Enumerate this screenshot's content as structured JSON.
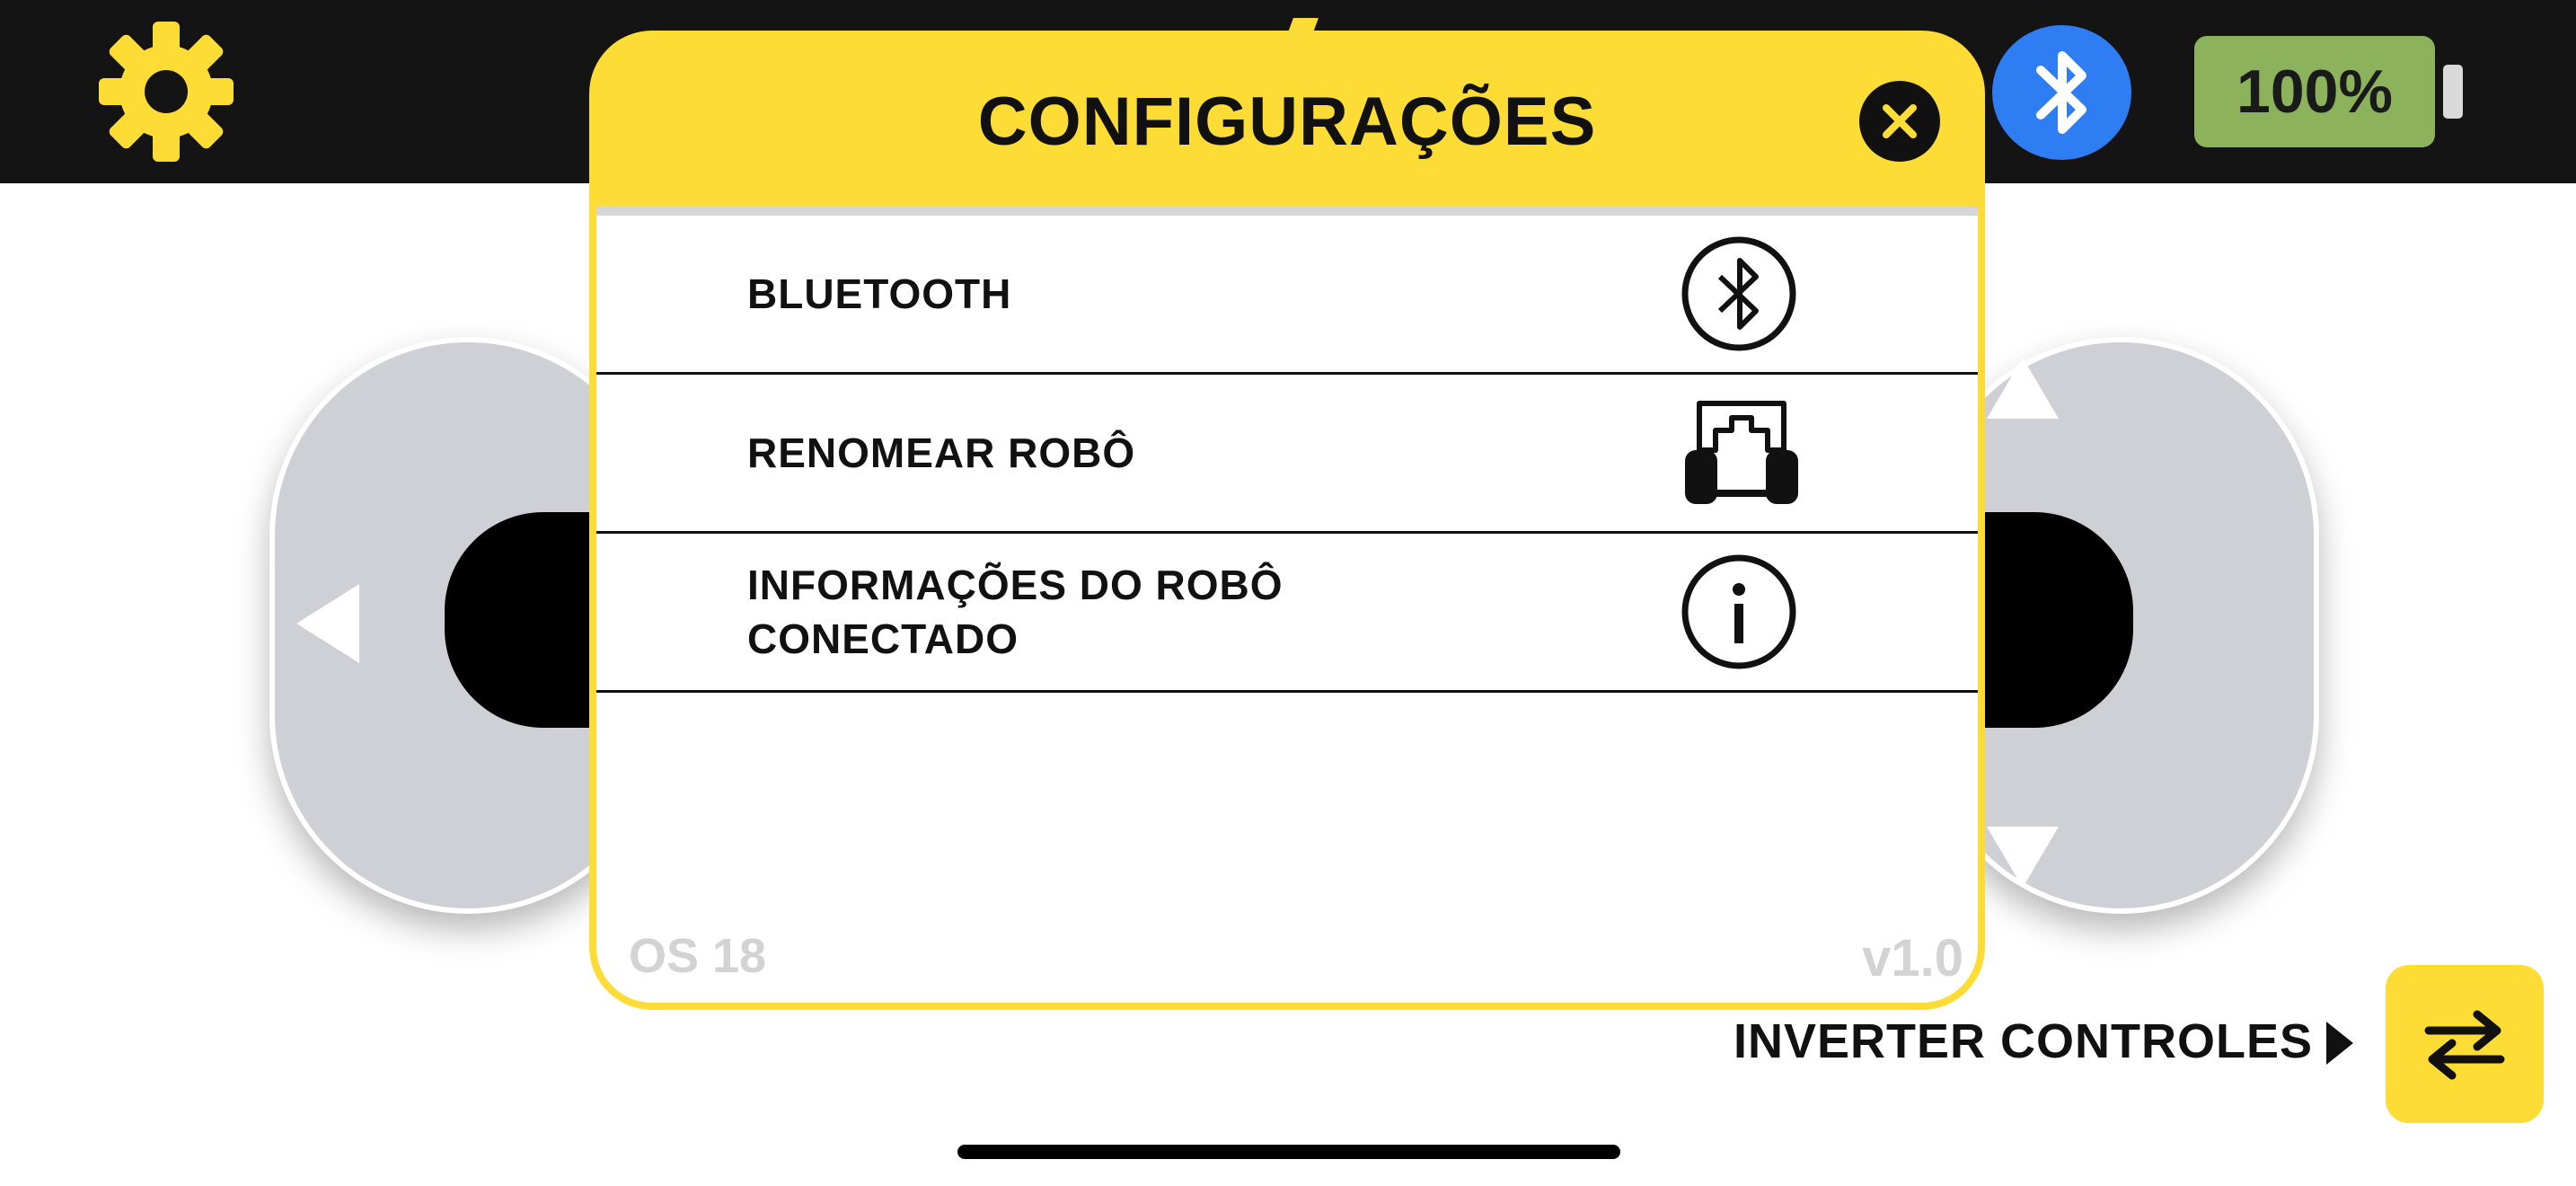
{
  "topbar": {
    "settings_icon": "gear-icon",
    "bluetooth_icon": "bluetooth-icon",
    "battery": "100%"
  },
  "colors": {
    "accent_yellow": "#fddd35",
    "topbar_bg": "#141414",
    "bluetooth_blue": "#2f7df3",
    "battery_green": "#8cb35b",
    "pad_gray": "#cfd0d5"
  },
  "modal": {
    "title": "CONFIGURAÇÕES",
    "close_icon": "close-icon",
    "items": [
      {
        "label": "BLUETOOTH",
        "icon": "bluetooth-circle-icon"
      },
      {
        "label": "RENOMEAR ROBÔ",
        "icon": "robot-icon"
      },
      {
        "label_line1": "INFORMAÇÕES DO ROBÔ",
        "label_line2": "CONECTADO",
        "icon": "info-icon"
      }
    ],
    "footer_left": "OS 18",
    "footer_right": "v1.0"
  },
  "controls": {
    "invert_label": "INVERTER CONTROLES",
    "invert_icon": "swap-arrows-icon"
  }
}
